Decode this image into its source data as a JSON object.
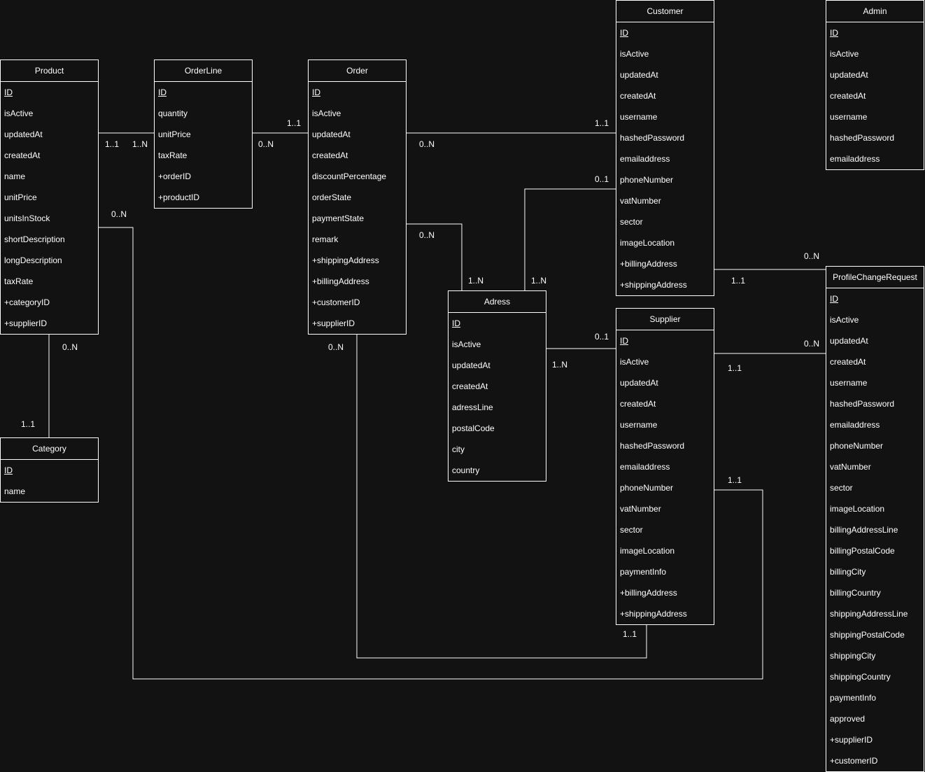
{
  "colors": {
    "background": "#121212",
    "line": "#ffffff",
    "text": "#ffffff"
  },
  "entities": {
    "product": {
      "title": "Product",
      "pk": "ID",
      "attrs": [
        "isActive",
        "updatedAt",
        "createdAt",
        "name",
        "unitPrice",
        "unitsInStock",
        "shortDescription",
        "longDescription",
        "taxRate",
        "+categoryID",
        "+supplierID"
      ]
    },
    "orderline": {
      "title": "OrderLine",
      "pk": "ID",
      "attrs": [
        "quantity",
        "unitPrice",
        "taxRate",
        "+orderID",
        "+productID"
      ]
    },
    "order": {
      "title": "Order",
      "pk": "ID",
      "attrs": [
        "isActive",
        "updatedAt",
        "createdAt",
        "discountPercentage",
        "orderState",
        "paymentState",
        "remark",
        "+shippingAddress",
        "+billingAddress",
        "+customerID",
        "+supplierID"
      ]
    },
    "customer": {
      "title": "Customer",
      "pk": "ID",
      "attrs": [
        "isActive",
        "updatedAt",
        "createdAt",
        "username",
        "hashedPassword",
        "emailaddress",
        "phoneNumber",
        "vatNumber",
        "sector",
        "imageLocation",
        "+billingAddress",
        "+shippingAddress"
      ]
    },
    "admin": {
      "title": "Admin",
      "pk": "ID",
      "attrs": [
        "isActive",
        "updatedAt",
        "createdAt",
        "username",
        "hashedPassword",
        "emailaddress"
      ]
    },
    "category": {
      "title": "Category",
      "pk": "ID",
      "attrs": [
        "name"
      ]
    },
    "adress": {
      "title": "Adress",
      "pk": "ID",
      "attrs": [
        "isActive",
        "updatedAt",
        "createdAt",
        "adressLine",
        "postalCode",
        "city",
        "country"
      ]
    },
    "supplier": {
      "title": "Supplier",
      "pk": "ID",
      "attrs": [
        "isActive",
        "updatedAt",
        "createdAt",
        "username",
        "hashedPassword",
        "emailaddress",
        "phoneNumber",
        "vatNumber",
        "sector",
        "imageLocation",
        "paymentInfo",
        "+billingAddress",
        "+shippingAddress"
      ]
    },
    "profilechangerequest": {
      "title": "ProfileChangeRequest",
      "pk": "ID",
      "attrs": [
        "isActive",
        "updatedAt",
        "createdAt",
        "username",
        "hashedPassword",
        "emailaddress",
        "phoneNumber",
        "vatNumber",
        "sector",
        "imageLocation",
        "billingAddressLine",
        "billingPostalCode",
        "billingCity",
        "billingCountry",
        "shippingAddressLine",
        "shippingPostalCode",
        "shippingCity",
        "shippingCountry",
        "paymentInfo",
        "approved",
        "+supplierID",
        "+customerID"
      ]
    }
  },
  "multiplicities": {
    "product_orderline_product": "1..1",
    "product_orderline_orderline": "1..N",
    "orderline_order_orderline": "0..N",
    "orderline_order_order": "1..1",
    "order_customer_order": "0..N",
    "order_customer_customer": "1..1",
    "customer_adress_customer": "0..1",
    "customer_adress_adress": "1..N",
    "order_adress_order": "0..N",
    "order_adress_adress": "1..N",
    "product_category_product": "0..N",
    "product_category_category": "1..1",
    "product_supplier_product": "0..N",
    "order_supplier_order": "0..N",
    "adress_supplier_adress": "1..N",
    "adress_supplier_supplier": "0..1",
    "customer_pcr_customer": "1..1",
    "customer_pcr_pcr": "0..N",
    "supplier_pcr_supplier": "1..1",
    "supplier_pcr_pcr": "0..N",
    "supplier_order_supplier": "1..1",
    "supplier_product_supplier": "1..1"
  }
}
